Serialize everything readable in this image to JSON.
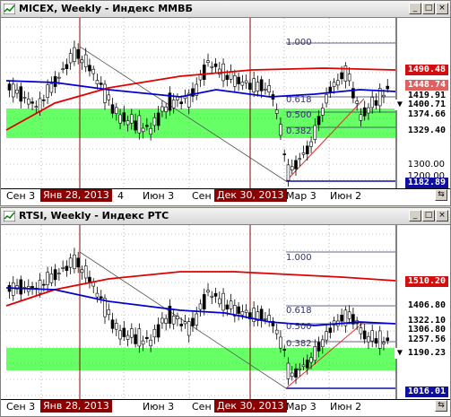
{
  "panels": [
    {
      "title": "MICEX, Weekly - Индекс ММВБ",
      "buttons": [
        "_",
        "□",
        "×"
      ],
      "fib_levels": [
        "1.000",
        "0.618",
        "0.500",
        "0.382"
      ],
      "price_labels": [
        {
          "text": "1490.48",
          "color": "#d01010"
        },
        {
          "text": "1448.74",
          "color": "#e06060"
        },
        {
          "text": "1419.91",
          "color": "#000000"
        },
        {
          "text": "▼ 1400.71",
          "color": "#000000"
        },
        {
          "text": "1374.66",
          "color": "#000000"
        },
        {
          "text": "1329.40",
          "color": "#000000"
        },
        {
          "text": "1182.89",
          "color": "#1010a0"
        }
      ],
      "y_ticks": [
        "1300.00",
        "1200.00"
      ],
      "x_ticks": [
        "Сен 3",
        "Янв 28, 2013",
        "4",
        "Июн 3",
        "Сен",
        "Дек 30, 2013",
        "Мар 3",
        "Июн 2"
      ],
      "scroll_icon": "⇆"
    },
    {
      "title": "RTSI, Weekly - Индекс РТС",
      "buttons": [
        "_",
        "□",
        "×"
      ],
      "fib_levels": [
        "1.000",
        "0.618",
        "0.500",
        "0.382"
      ],
      "price_labels": [
        {
          "text": "1510.20",
          "color": "#d01010"
        },
        {
          "text": "1406.80",
          "color": "#000000"
        },
        {
          "text": "1322.10",
          "color": "#000000"
        },
        {
          "text": "1306.80",
          "color": "#000000"
        },
        {
          "text": "1257.56",
          "color": "#000000"
        },
        {
          "text": "▼ 1190.23",
          "color": "#000000"
        },
        {
          "text": "1016.01",
          "color": "#1010a0"
        }
      ],
      "y_ticks": [],
      "x_ticks": [
        "Сен 3",
        "Янв 28, 2013",
        "Июн 3",
        "Сен",
        "Дек 30, 2013",
        "Мар 3",
        "Июн 2"
      ],
      "scroll_icon": "⇆"
    }
  ],
  "colors": {
    "ma_red": "#e00000",
    "ma_blue": "#0000d0",
    "green_zone": "#66ff66",
    "highlight": "#8b0000",
    "candle_up": "#ffffff",
    "candle_down": "#000000"
  }
}
